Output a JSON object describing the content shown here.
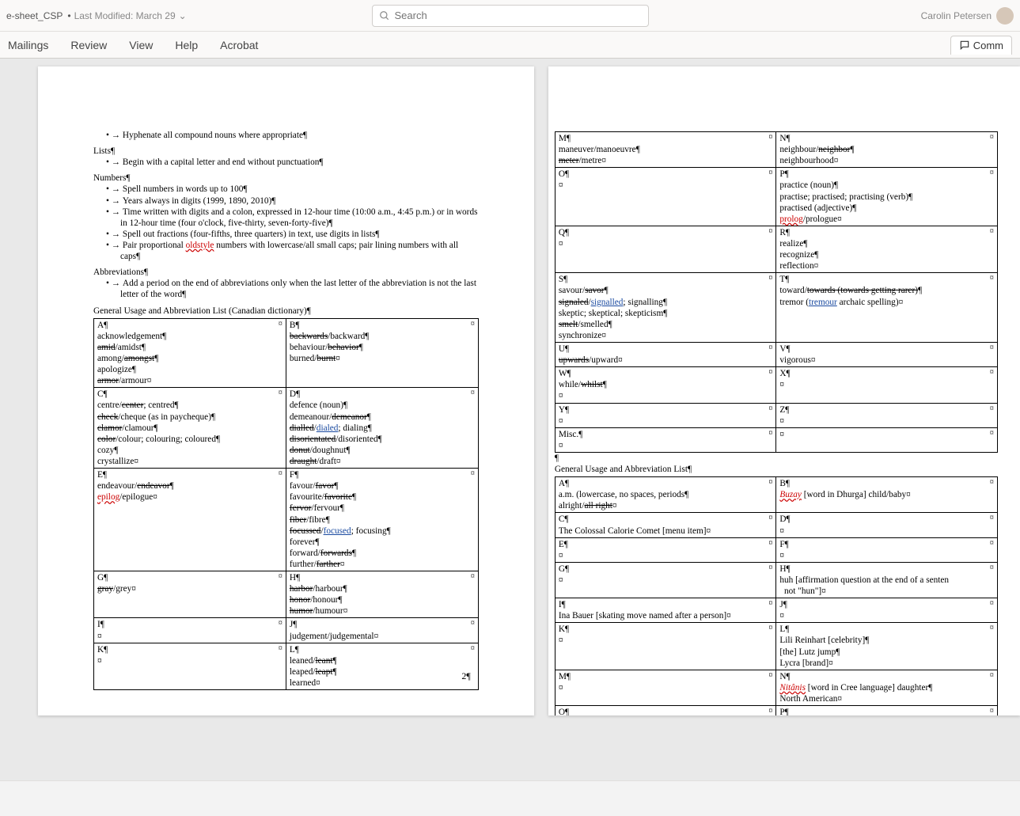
{
  "header": {
    "doc_title": "e-sheet_CSP",
    "modified": "Last Modified: March 29",
    "search_placeholder": "Search",
    "user_name": "Carolin Petersen"
  },
  "ribbon": {
    "tabs": [
      "Mailings",
      "Review",
      "View",
      "Help",
      "Acrobat"
    ],
    "comments_label": "Comm"
  },
  "page2": {
    "bullets_top": [
      "Hyphenate all compound nouns where appropriate¶"
    ],
    "lists_heading": "Lists¶",
    "lists_bullets": [
      "Begin with a capital letter and end without punctuation¶"
    ],
    "numbers_heading": "Numbers¶",
    "numbers_bullets": [
      "Spell numbers in words up to 100¶",
      "Years always in digits (1999, 1890, 2010)¶",
      "Time written with digits and a colon, expressed in 12-hour time (10:00 a.m., 4:45 p.m.) or in words in 12-hour time (four o'clock, five-thirty, seven-forty-five)¶",
      "Spell out fractions (four-fifths, three quarters) in text, use digits in lists¶",
      "Pair proportional <sq>oldstyle</sq> numbers with lowercase/all small caps; pair lining numbers with all caps¶"
    ],
    "abbrev_heading": "Abbreviations¶",
    "abbrev_bullets": [
      "Add a period on the end of abbreviations only when the last letter of the abbreviation is not the last letter of the word¶"
    ],
    "table_title": "General Usage and Abbreviation List (Canadian dictionary)¶",
    "table_rows": [
      {
        "l": "A¶<br>acknowledgement¶<br><st>amid</st>/amidst¶<br>among/<st>amongst</st>¶<br>apologize¶<br><st>armor</st>/armour¤",
        "r": "B¶<br><st>backwards</st>/backward¶<br>behaviour/<st>behavior</st>¶<br>burned/<st>burnt</st>¤"
      },
      {
        "l": "C¶<br>centre/<st>center</st>; centred¶<br><st>check</st>/cheque (as in paycheque)¶<br><st>clamor</st>/clamour¶<br><st>color</st>/colour; colouring; coloured¶<br>cozy¶<br>crystallize¤",
        "r": "D¶<br>defence (noun)¶<br>demeanour/<st>demeanor</st>¶<br><st>dialled</st>/<bu>dialed</bu>; dialing¶<br><st>disorientated</st>/disoriented¶<br><st>donut</st>/doughnut¶<br><st>draught</st>/draft¤"
      },
      {
        "l": "E¶<br>endeavour/<st>endeavor</st>¶<br><sq>epilog</sq>/epilogue¤",
        "r": "F¶<br>favour/<st>favor</st>¶<br>favourite/<st>favorite</st>¶<br><st>fervor</st>/fervour¶<br><st>fiber</st>/fibre¶<br><st>focussed</st>/<bu>focused</bu>; focusing¶<br>forever¶<br>forward/<st>forwards</st>¶<br>further/<st>farther</st>¤"
      },
      {
        "l": "G¶<br><st>gray</st>/grey¤",
        "r": "H¶<br><st>harbor</st>/harbour¶<br><st>honor</st>/honour¶<br><st>humor</st>/humour¤"
      },
      {
        "l": "I¶<br>¤",
        "r": "J¶<br>judgement/judgemental¤"
      },
      {
        "l": "K¶<br>¤",
        "r": "L¶<br>leaned/<st>leant</st>¶<br>leaped/<st>leapt</st>¶<br>learned¤"
      }
    ],
    "page_num": "2¶"
  },
  "page3": {
    "table1_rows": [
      {
        "l": "M¶<br>maneuver/manoeuvre¶<br><st>meter</st>/metre¤",
        "r": "N¶<br>neighbour/<st>neighbor</st>¶<br>neighbourhood¤"
      },
      {
        "l": "O¶<br>¤",
        "r": "P¶<br>practice (noun)¶<br>practise; practised; practising (verb)¶<br>practised (adjective)¶<br><sq>prolog</sq>/prologue¤"
      },
      {
        "l": "Q¶<br>¤",
        "r": "R¶<br>realize¶<br>recognize¶<br>reflection¤"
      },
      {
        "l": "S¶<br>savour/<st>savor</st>¶<br><st>signaled</st>/<bu>signalled</bu>; signalling¶<br>skeptic; skeptical; skepticism¶<br><st>smelt</st>/smelled¶<br>synchronize¤",
        "r": "T¶<br>toward/<st>towards (towards getting rarer)</st>¶<br>tremor (<bu>tremour</bu> archaic spelling)¤"
      },
      {
        "l": "U¶<br><st>upwards</st>/upward¤",
        "r": "V¶<br>vigorous¤"
      },
      {
        "l": "W¶<br>while/<st>whilst</st>¶<br>¤",
        "r": "X¶<br>¤"
      },
      {
        "l": "Y¶<br>¤",
        "r": "Z¶<br>¤"
      },
      {
        "l": "Misc.¶<br>¤",
        "r": "¤"
      }
    ],
    "spacer": "¶",
    "table2_title": "General Usage and Abbreviation List¶",
    "table2_rows": [
      {
        "l": "A¶<br>a.m. (lowercase, no spaces, periods¶<br>alright/<st>all right</st>¤",
        "r": "B¶<br><it><sq>Buzay</sq></it> [word in Dhurga] child/baby¤"
      },
      {
        "l": "C¶<br>The Colossal Calorie Comet [menu item]¤",
        "r": "D¶<br>¤"
      },
      {
        "l": "E¶<br>¤",
        "r": "F¶<br>¤"
      },
      {
        "l": "G¶<br>¤",
        "r": "H¶<br>huh [affirmation question at the end of a senten<br>&nbsp;&nbsp;not \"hun\"]¤"
      },
      {
        "l": "I¶<br>Ina Bauer [skating move named after a person]¤",
        "r": "J¶<br>¤"
      },
      {
        "l": "K¶<br>¤",
        "r": "L¶<br>Lili Reinhart [celebrity]¶<br>[the] Lutz jump¶<br>Lycra [brand]¤"
      },
      {
        "l": "M¶<br>¤",
        "r": "N¶<br><it><sq>Nitânis</sq></it> [word in Cree language] daughter¶<br>North American¤"
      },
      {
        "l": "O¶",
        "r": "P¶"
      }
    ]
  }
}
